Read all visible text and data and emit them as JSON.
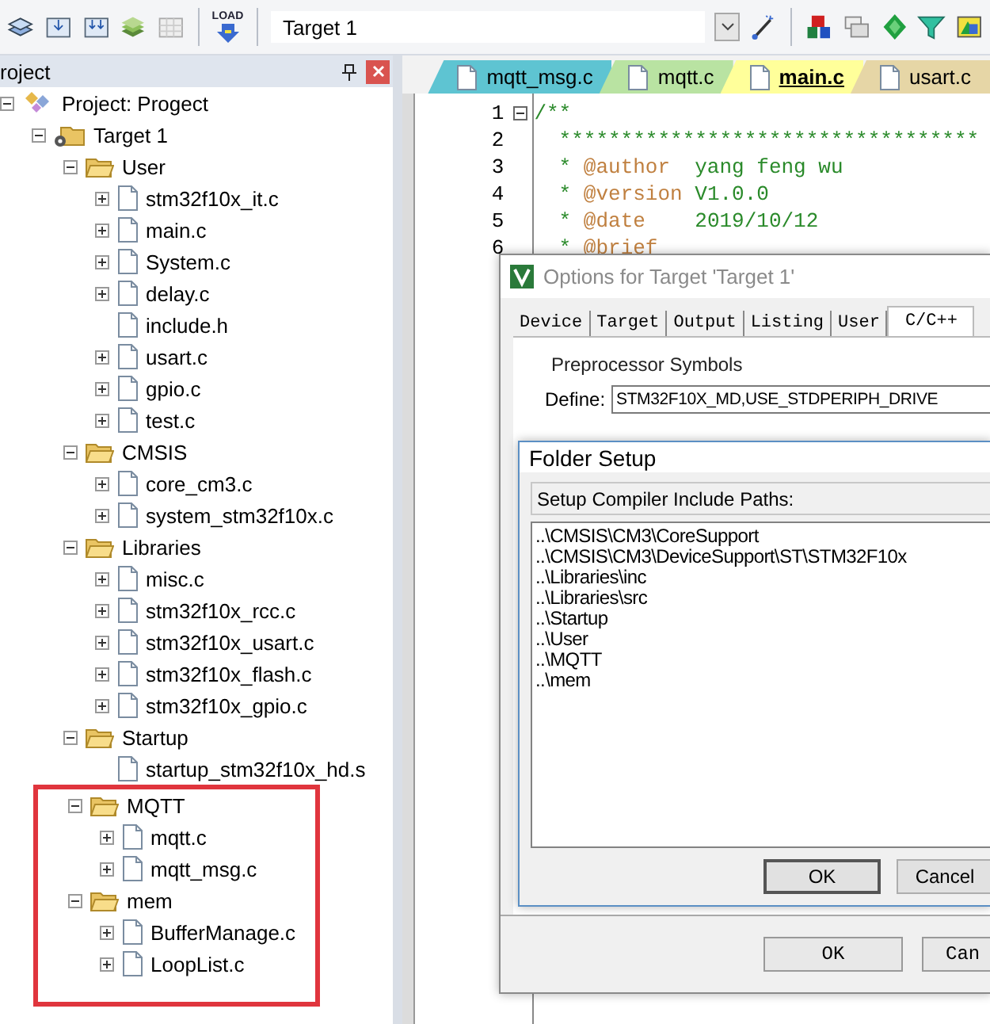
{
  "toolbar": {
    "load_label": "LOAD",
    "target": "Target 1"
  },
  "project_panel": {
    "title": "roject"
  },
  "tree": {
    "label": "Project: Progect",
    "kind": "project",
    "expanded": true,
    "children": [
      {
        "label": "Target 1",
        "kind": "target",
        "expanded": true,
        "children": [
          {
            "label": "User",
            "kind": "group",
            "expanded": true,
            "highlighted": false,
            "children": [
              {
                "label": "stm32f10x_it.c",
                "kind": "file",
                "expandable": true
              },
              {
                "label": "main.c",
                "kind": "file",
                "expandable": true
              },
              {
                "label": "System.c",
                "kind": "file",
                "expandable": true
              },
              {
                "label": "delay.c",
                "kind": "file",
                "expandable": true
              },
              {
                "label": "include.h",
                "kind": "file",
                "expandable": false
              },
              {
                "label": "usart.c",
                "kind": "file",
                "expandable": true
              },
              {
                "label": "gpio.c",
                "kind": "file",
                "expandable": true
              },
              {
                "label": "test.c",
                "kind": "file",
                "expandable": true
              }
            ]
          },
          {
            "label": "CMSIS",
            "kind": "group",
            "expanded": true,
            "highlighted": false,
            "children": [
              {
                "label": "core_cm3.c",
                "kind": "file",
                "expandable": true
              },
              {
                "label": "system_stm32f10x.c",
                "kind": "file",
                "expandable": true
              }
            ]
          },
          {
            "label": "Libraries",
            "kind": "group",
            "expanded": true,
            "highlighted": false,
            "children": [
              {
                "label": "misc.c",
                "kind": "file",
                "expandable": true
              },
              {
                "label": "stm32f10x_rcc.c",
                "kind": "file",
                "expandable": true
              },
              {
                "label": "stm32f10x_usart.c",
                "kind": "file",
                "expandable": true
              },
              {
                "label": "stm32f10x_flash.c",
                "kind": "file",
                "expandable": true
              },
              {
                "label": "stm32f10x_gpio.c",
                "kind": "file",
                "expandable": true
              }
            ]
          },
          {
            "label": "Startup",
            "kind": "group",
            "expanded": true,
            "highlighted": false,
            "children": [
              {
                "label": "startup_stm32f10x_hd.s",
                "kind": "file",
                "expandable": false
              }
            ]
          },
          {
            "label": "MQTT",
            "kind": "group",
            "expanded": true,
            "highlighted": true,
            "children": [
              {
                "label": "mqtt.c",
                "kind": "file",
                "expandable": true
              },
              {
                "label": "mqtt_msg.c",
                "kind": "file",
                "expandable": true
              }
            ]
          },
          {
            "label": "mem",
            "kind": "group",
            "expanded": true,
            "highlighted": true,
            "children": [
              {
                "label": "BufferManage.c",
                "kind": "file",
                "expandable": true
              },
              {
                "label": "LoopList.c",
                "kind": "file",
                "expandable": true
              }
            ]
          }
        ]
      }
    ]
  },
  "editor": {
    "tabs": [
      {
        "label": "mqtt_msg.c",
        "color": "#5ec4d2",
        "selected": false
      },
      {
        "label": "mqtt.c",
        "color": "#b9e3a2",
        "selected": false
      },
      {
        "label": "main.c",
        "color": "#ffff9a",
        "selected": true
      },
      {
        "label": "usart.c",
        "color": "#e6d6a6",
        "selected": false
      }
    ],
    "lines": [
      {
        "number": "1",
        "fold": true,
        "text": "/**"
      },
      {
        "number": "2",
        "fold": false,
        "text": "  **********************************"
      },
      {
        "number": "3",
        "fold": false,
        "text": "  * ",
        "tag": "@author",
        "value": "  yang feng wu"
      },
      {
        "number": "4",
        "fold": false,
        "text": "  * ",
        "tag": "@version",
        "value": " V1.0.0"
      },
      {
        "number": "5",
        "fold": false,
        "text": "  * ",
        "tag": "@date",
        "value": "    2019/10/12"
      },
      {
        "number": "6",
        "fold": false,
        "text": "  * ",
        "tag": "@brief"
      }
    ]
  },
  "options_dialog": {
    "title": "Options for Target 'Target 1'",
    "tabs": [
      {
        "label": "Device",
        "selected": false
      },
      {
        "label": "Target",
        "selected": false
      },
      {
        "label": "Output",
        "selected": false
      },
      {
        "label": "Listing",
        "selected": false
      },
      {
        "label": "User",
        "selected": false
      },
      {
        "label": "C/C++",
        "selected": true
      }
    ],
    "group_title": "Preprocessor Symbols",
    "define_label": "Define:",
    "define_value": "STM32F10X_MD,USE_STDPERIPH_DRIVE",
    "buttons": [
      "OK",
      "Can"
    ]
  },
  "folder_dialog": {
    "title": "Folder Setup",
    "list_header": "Setup Compiler Include Paths:",
    "paths": [
      "..\\CMSIS\\CM3\\CoreSupport",
      "..\\CMSIS\\CM3\\DeviceSupport\\ST\\STM32F10x",
      "..\\Libraries\\inc",
      "..\\Libraries\\src",
      "..\\Startup",
      "..\\User",
      "..\\MQTT",
      "..\\mem"
    ],
    "buttons": [
      "OK",
      "Cancel"
    ]
  }
}
